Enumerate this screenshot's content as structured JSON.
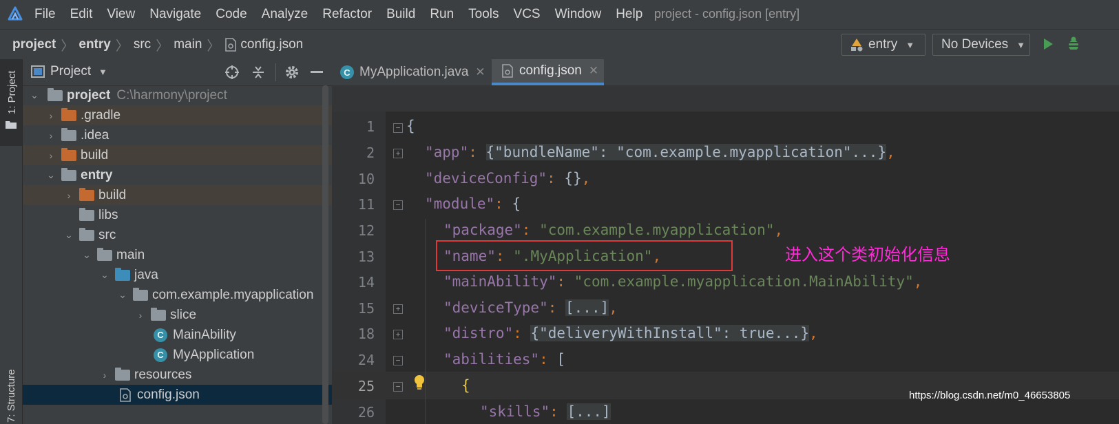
{
  "menu": {
    "items": [
      "File",
      "Edit",
      "View",
      "Navigate",
      "Code",
      "Analyze",
      "Refactor",
      "Build",
      "Run",
      "Tools",
      "VCS",
      "Window",
      "Help"
    ],
    "window_title": "project - config.json [entry]"
  },
  "navbar": {
    "crumbs": [
      "project",
      "entry",
      "src",
      "main",
      "config.json"
    ],
    "run_config": "entry",
    "device": "No Devices"
  },
  "sidebar": {
    "project_tab": "1: Project",
    "structure_tab": "7: Structure"
  },
  "project_panel": {
    "title": "Project",
    "tree": [
      {
        "label": "project",
        "path": "C:\\harmony\\project",
        "depth": 0,
        "expanded": true,
        "bold": true,
        "icon": "module-folder"
      },
      {
        "label": ".gradle",
        "depth": 1,
        "expanded": false,
        "icon": "orange-folder",
        "highlight": true
      },
      {
        "label": ".idea",
        "depth": 1,
        "expanded": false,
        "icon": "gray-folder"
      },
      {
        "label": "build",
        "depth": 1,
        "expanded": false,
        "icon": "orange-folder",
        "highlight": true
      },
      {
        "label": "entry",
        "depth": 1,
        "expanded": true,
        "bold": true,
        "icon": "module-folder"
      },
      {
        "label": "build",
        "depth": 2,
        "expanded": false,
        "icon": "orange-folder",
        "highlight": true
      },
      {
        "label": "libs",
        "depth": 2,
        "icon": "gray-folder"
      },
      {
        "label": "src",
        "depth": 2,
        "expanded": true,
        "icon": "gray-folder"
      },
      {
        "label": "main",
        "depth": 3,
        "expanded": true,
        "icon": "gray-folder"
      },
      {
        "label": "java",
        "depth": 4,
        "expanded": true,
        "icon": "blue-folder"
      },
      {
        "label": "com.example.myapplication",
        "depth": 5,
        "expanded": true,
        "icon": "package-folder"
      },
      {
        "label": "slice",
        "depth": 6,
        "expanded": false,
        "icon": "package-folder"
      },
      {
        "label": "MainAbility",
        "depth": 6,
        "icon": "class-icon"
      },
      {
        "label": "MyApplication",
        "depth": 6,
        "icon": "class-icon"
      },
      {
        "label": "resources",
        "depth": 4,
        "expanded": false,
        "icon": "resources-folder"
      },
      {
        "label": "config.json",
        "depth": 4,
        "icon": "json-file",
        "selected": true
      }
    ]
  },
  "editor": {
    "tabs": [
      {
        "label": "MyApplication.java",
        "active": false
      },
      {
        "label": "config.json",
        "active": true
      }
    ],
    "lines": [
      {
        "num": "1"
      },
      {
        "num": "2"
      },
      {
        "num": "10"
      },
      {
        "num": "11"
      },
      {
        "num": "12"
      },
      {
        "num": "13"
      },
      {
        "num": "14"
      },
      {
        "num": "15"
      },
      {
        "num": "18"
      },
      {
        "num": "24"
      },
      {
        "num": "25"
      },
      {
        "num": "26"
      }
    ],
    "code": {
      "l1": "{",
      "l2_key": "\"app\"",
      "l2_val": "{\"bundleName\": \"com.example.myapplication\"...}",
      "l10_key": "\"deviceConfig\"",
      "l10_val": "{}",
      "l11_key": "\"module\"",
      "l11_val": "{",
      "l12_key": "\"package\"",
      "l12_val": "\"com.example.myapplication\"",
      "l13_key": "\"name\"",
      "l13_val": "\".MyApplication\"",
      "l14_key": "\"mainAbility\"",
      "l14_val": "\"com.example.myapplication.MainAbility\"",
      "l15_key": "\"deviceType\"",
      "l15_val": "[...]",
      "l18_key": "\"distro\"",
      "l18_val": "{\"deliveryWithInstall\": true...}",
      "l24_key": "\"abilities\"",
      "l24_val": "[",
      "l25": "{",
      "l26_key": "\"skills\"",
      "l26_val": "[...]"
    }
  },
  "annotation": "进入这个类初始化信息",
  "watermark": "https://blog.csdn.net/m0_46653805",
  "colors": {
    "annotation": "#ff2ad8",
    "highlight_box": "#e0393a",
    "active_tab_underline": "#4a88c7"
  }
}
